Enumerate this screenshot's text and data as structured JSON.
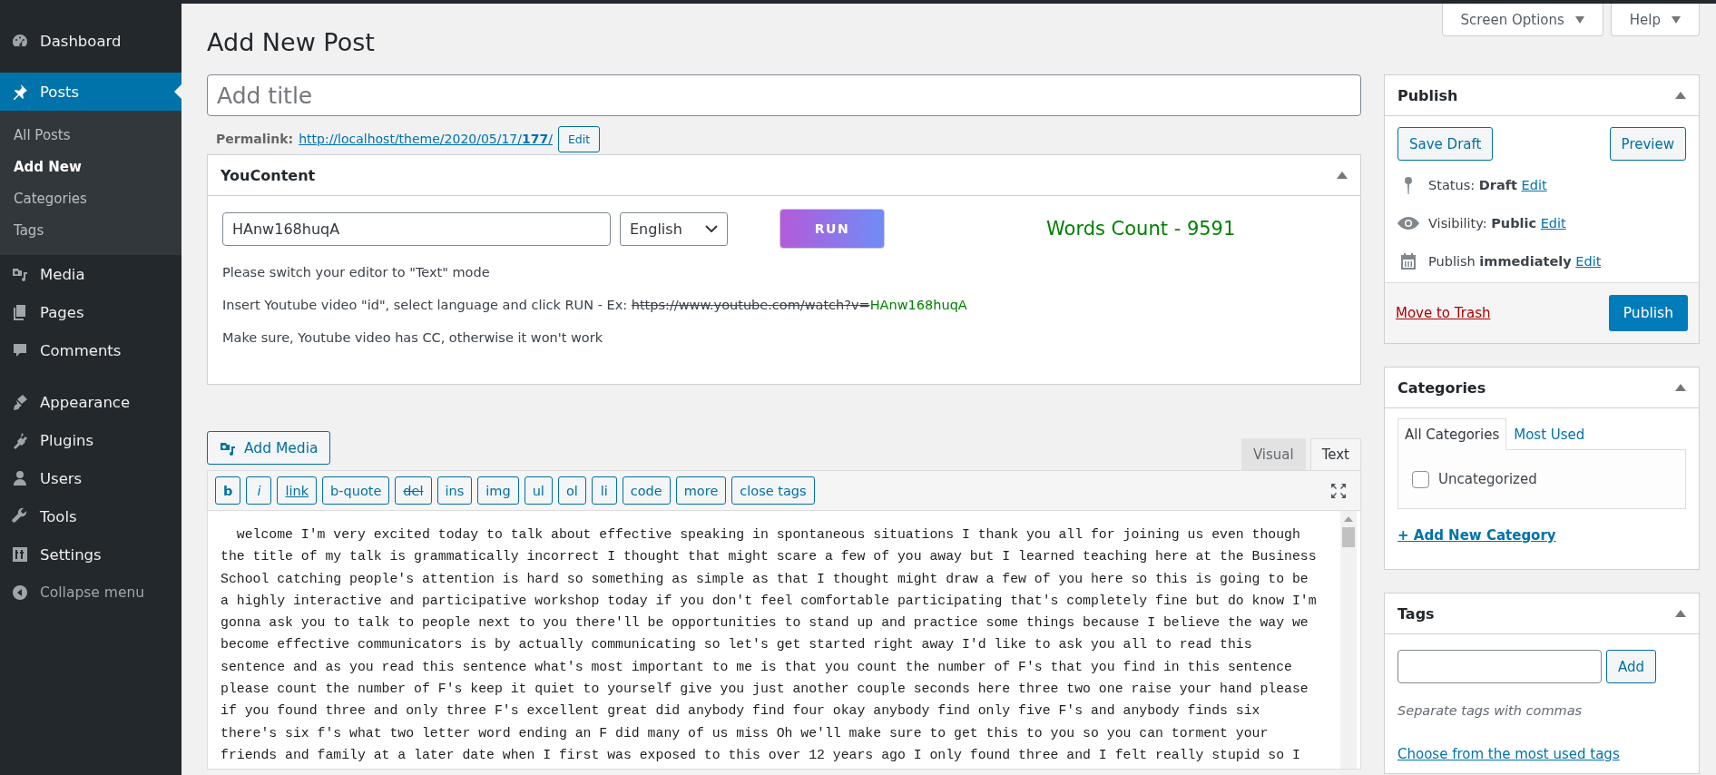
{
  "sidebar": {
    "groups": [
      [
        {
          "label": "Dashboard",
          "selected": false
        }
      ],
      [
        {
          "label": "Posts",
          "selected": true,
          "children": [
            {
              "label": "All Posts",
              "selected": false
            },
            {
              "label": "Add New",
              "selected": true
            },
            {
              "label": "Categories",
              "selected": false
            },
            {
              "label": "Tags",
              "selected": false
            }
          ]
        },
        {
          "label": "Media",
          "selected": false
        },
        {
          "label": "Pages",
          "selected": false
        },
        {
          "label": "Comments",
          "selected": false
        }
      ],
      [
        {
          "label": "Appearance",
          "selected": false
        },
        {
          "label": "Plugins",
          "selected": false
        },
        {
          "label": "Users",
          "selected": false
        },
        {
          "label": "Tools",
          "selected": false
        },
        {
          "label": "Settings",
          "selected": false
        }
      ]
    ],
    "collapse": "Collapse menu"
  },
  "header": {
    "title": "Add New Post",
    "buttons": [
      "Screen Options",
      "Help"
    ]
  },
  "title_field": {
    "placeholder": "Add title"
  },
  "permalink": {
    "label": "Permalink:",
    "url": "http://localhost/theme/2020/05/17/**177**/",
    "button": "Edit"
  },
  "youcontent": {
    "title": "YouContent",
    "video_id": "HAnw168huqA",
    "language": "English",
    "run_button": "RUN",
    "words_count": "Words Count - 9591",
    "notes": [
      {
        "kind": "plain",
        "text": "Please switch your editor to \"Text\" mode"
      },
      {
        "kind": "example",
        "text": "Insert Youtube video \"id\", select language and click RUN - Ex:",
        "struck": "https://www.youtube.com/watch?v=",
        "highlight": "HAnw168huqA"
      },
      {
        "kind": "plain",
        "text": "Make sure, Youtube video has CC, otherwise it won't work"
      }
    ]
  },
  "editor": {
    "add_media": "Add Media",
    "tabs": [
      {
        "label": "Visual",
        "selected": false
      },
      {
        "label": "Text",
        "selected": true
      }
    ],
    "quicktags": [
      "b",
      "i",
      "link",
      "b-quote",
      "del",
      "ins",
      "img",
      "ul",
      "ol",
      "li",
      "code",
      "more",
      "close tags"
    ],
    "lines": [
      "  welcome I'm very excited today to talk about effective speaking in spontaneous situations I thank you all for joining us even though",
      "the title of my talk is grammatically incorrect I thought that might scare a few of you away but I learned teaching here at the Business",
      "School catching people's attention is hard so something as simple as that I thought might draw a few of you here so this is going to be",
      "a highly interactive and participative workshop today if you don't feel comfortable participating that's completely fine but do know I'm",
      "gonna ask you to talk to people next to you there'll be opportunities to stand up and practice some things because I believe the way we",
      "become effective communicators is by actually communicating so let's get started right away I'd like to ask you all to read this",
      "sentence and as you read this sentence what's most important to me is that you count the number of F's that you find in this sentence",
      "please count the number of F's keep it quiet to yourself give you just another couple seconds here three two one raise your hand please",
      "if you found three and only three F's excellent great did anybody find four okay anybody find only five F's and anybody finds six",
      "there's six f's what two letter word ending an F did many of us miss Oh we'll make sure to get this to you so you can torment your",
      "friends and family at a later date when I first was exposed to this over 12 years ago I only found three and I felt really stupid so I"
    ]
  },
  "publish": {
    "title": "Publish",
    "save_draft": "Save Draft",
    "preview": "Preview",
    "rows": [
      {
        "text": "Status: **Draft**",
        "link": "Edit"
      },
      {
        "text": "Visibility: **Public**",
        "link": "Edit"
      },
      {
        "text": "Publish **immediately**",
        "link": "Edit"
      }
    ],
    "trash": "Move to Trash",
    "publish_button": "Publish"
  },
  "categories": {
    "title": "Categories",
    "tabs": [
      {
        "label": "All Categories",
        "selected": true
      },
      {
        "label": "Most Used",
        "selected": false
      }
    ],
    "items": [
      {
        "label": "Uncategorized",
        "checked": false
      }
    ],
    "add_link": "+ Add New Category"
  },
  "tags": {
    "title": "Tags",
    "button": "Add",
    "hint": "Separate tags with commas",
    "link": "Choose from the most used tags"
  }
}
